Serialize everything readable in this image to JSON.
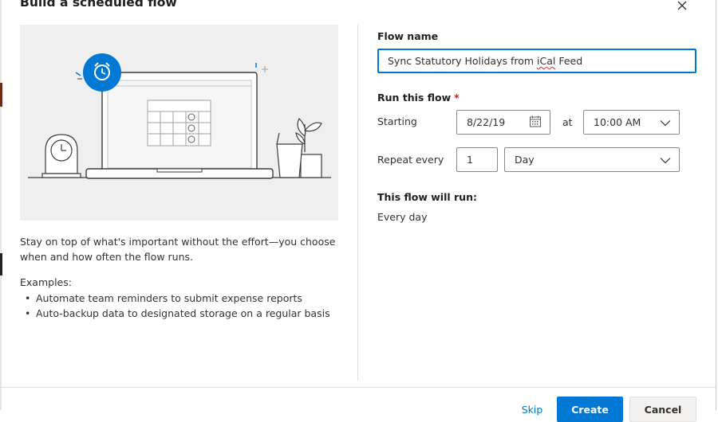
{
  "dialog": {
    "title": "Build a scheduled flow",
    "close_icon": "close-icon"
  },
  "left": {
    "description": "Stay on top of what's important without the effort—you choose when and how often the flow runs.",
    "examples_label": "Examples:",
    "examples": [
      "Automate team reminders to submit expense reports",
      "Auto-backup data to designated storage on a regular basis"
    ]
  },
  "form": {
    "flow_name_label": "Flow name",
    "flow_name_value": "Sync Statutory Holidays from iCal Feed",
    "flow_name_before": "Sync Statutory Holidays from ",
    "flow_name_misspelled": "iCal",
    "flow_name_after": " Feed",
    "run_label": "Run this flow",
    "required_marker": "*",
    "starting_label": "Starting",
    "start_date": "8/22/19",
    "calendar_icon": "calendar-icon",
    "at_label": "at",
    "start_time": "10:00 AM",
    "repeat_label": "Repeat every",
    "repeat_interval": "1",
    "repeat_unit": "Day",
    "summary_label": "This flow will run:",
    "summary_value": "Every day"
  },
  "footer": {
    "skip_label": "Skip",
    "create_label": "Create",
    "cancel_label": "Cancel"
  },
  "colors": {
    "accent": "#0078d4",
    "required": "#a4262c",
    "illustration_bg": "#efefef"
  }
}
